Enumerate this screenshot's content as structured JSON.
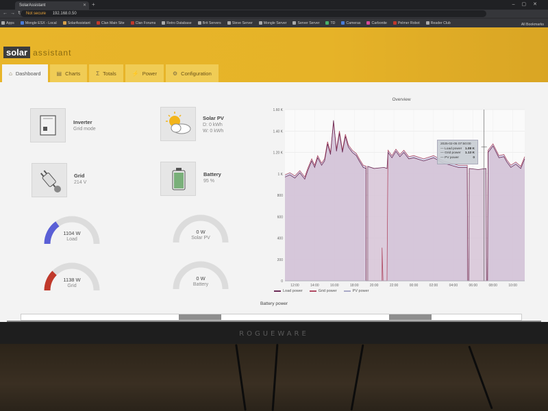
{
  "browser": {
    "tab_title": "SolarAssistant",
    "address_warning": "Not secure",
    "address_url": "192.168.0.50",
    "bookmarks": [
      "Apps",
      "Mongle ESX - Local",
      "SolarAssistant",
      "Clan Main Site",
      "Clan Forums",
      "Retro Database",
      "Brit Servers",
      "Steve Server",
      "Mongle Server",
      "Server Server",
      "TD",
      "Cameras",
      "Carbonite",
      "Pelmer Robot",
      "Reader Club"
    ],
    "all_bookmarks": "All Bookmarks"
  },
  "app": {
    "logo_box": "solar",
    "logo_rest": "assistant",
    "tabs": [
      {
        "label": "Dashboard",
        "icon": "home-icon",
        "active": true
      },
      {
        "label": "Charts",
        "icon": "chart-icon",
        "active": false
      },
      {
        "label": "Totals",
        "icon": "sigma-icon",
        "active": false
      },
      {
        "label": "Power",
        "icon": "bolt-icon",
        "active": false
      },
      {
        "label": "Configuration",
        "icon": "gear-icon",
        "active": false
      }
    ]
  },
  "tiles": {
    "inverter": {
      "title": "Inverter",
      "sub": "Grid mode"
    },
    "solar": {
      "title": "Solar PV",
      "sub1": "D: 0 kWh",
      "sub2": "W: 0 kWh"
    },
    "grid": {
      "title": "Grid",
      "sub": "214 V"
    },
    "battery": {
      "title": "Battery",
      "sub": "95 %"
    }
  },
  "gauges": {
    "load": {
      "value": "1104 W",
      "label": "Load",
      "fraction": 0.3,
      "color": "#5a5fd6"
    },
    "solar": {
      "value": "0 W",
      "label": "Solar PV",
      "fraction": 0,
      "color": "#5a5fd6"
    },
    "grid": {
      "value": "1138 W",
      "label": "Grid",
      "fraction": 0.25,
      "color": "#c0392b"
    },
    "battery": {
      "value": "0 W",
      "label": "Battery",
      "fraction": 0,
      "color": "#5a5fd6"
    }
  },
  "chart_data": {
    "type": "area",
    "title": "Overview",
    "x_ticks": [
      "12:00",
      "14:00",
      "16:00",
      "18:00",
      "20:00",
      "22:00",
      "00:00",
      "02:00",
      "04:00",
      "06:00",
      "08:00",
      "10:00"
    ],
    "y_ticks": [
      "0",
      "200",
      "400",
      "600",
      "800",
      "1 K",
      "1.20 K",
      "1.40 K",
      "1.60 K"
    ],
    "ylim": [
      0,
      1600
    ],
    "xlim": [
      11.0,
      35.2
    ],
    "series": [
      {
        "name": "Load power",
        "color": "#6b2a55",
        "points": [
          [
            11.0,
            970
          ],
          [
            11.5,
            990
          ],
          [
            12.0,
            960
          ],
          [
            12.5,
            1010
          ],
          [
            13.0,
            950
          ],
          [
            13.3,
            1030
          ],
          [
            13.7,
            1120
          ],
          [
            14.0,
            1060
          ],
          [
            14.3,
            1150
          ],
          [
            14.7,
            1080
          ],
          [
            15.0,
            1120
          ],
          [
            15.3,
            1280
          ],
          [
            15.6,
            1180
          ],
          [
            15.9,
            1500
          ],
          [
            16.2,
            1210
          ],
          [
            16.5,
            1380
          ],
          [
            16.8,
            1200
          ],
          [
            17.1,
            1350
          ],
          [
            17.4,
            1250
          ],
          [
            17.8,
            1200
          ],
          [
            18.2,
            1170
          ],
          [
            18.5,
            1120
          ],
          [
            18.9,
            1060
          ],
          [
            19.2,
            1050
          ],
          [
            19.2,
            0
          ],
          [
            19.35,
            0
          ],
          [
            19.35,
            1070
          ],
          [
            20.0,
            1050
          ],
          [
            21.0,
            1060
          ],
          [
            21.3,
            1050
          ],
          [
            21.4,
            1200
          ],
          [
            21.8,
            1150
          ],
          [
            22.2,
            1210
          ],
          [
            22.6,
            1160
          ],
          [
            23.0,
            1200
          ],
          [
            23.5,
            1140
          ],
          [
            24.0,
            1150
          ],
          [
            25.0,
            1120
          ],
          [
            26.0,
            1150
          ],
          [
            27.0,
            1100
          ],
          [
            28.5,
            1060
          ],
          [
            29.4,
            1060
          ],
          [
            29.45,
            0
          ],
          [
            29.55,
            0
          ],
          [
            29.6,
            1050
          ],
          [
            30.5,
            1040
          ],
          [
            31.3,
            1050
          ],
          [
            31.35,
            0
          ],
          [
            31.45,
            0
          ],
          [
            31.5,
            1200
          ],
          [
            32.0,
            1260
          ],
          [
            32.6,
            1150
          ],
          [
            33.1,
            1160
          ],
          [
            33.4,
            1110
          ],
          [
            33.8,
            1060
          ],
          [
            34.3,
            1090
          ],
          [
            34.8,
            1050
          ],
          [
            35.2,
            1140
          ]
        ]
      },
      {
        "name": "Grid power",
        "color": "#b04a63",
        "points": [
          [
            11.0,
            990
          ],
          [
            11.5,
            1010
          ],
          [
            12.0,
            980
          ],
          [
            12.5,
            1030
          ],
          [
            13.0,
            970
          ],
          [
            13.3,
            1050
          ],
          [
            13.7,
            1140
          ],
          [
            14.0,
            1080
          ],
          [
            14.3,
            1170
          ],
          [
            14.7,
            1100
          ],
          [
            15.0,
            1140
          ],
          [
            15.3,
            1300
          ],
          [
            15.6,
            1200
          ],
          [
            15.9,
            1480
          ],
          [
            16.2,
            1230
          ],
          [
            16.5,
            1400
          ],
          [
            16.8,
            1220
          ],
          [
            17.1,
            1370
          ],
          [
            17.4,
            1270
          ],
          [
            17.8,
            1220
          ],
          [
            18.2,
            1190
          ],
          [
            18.5,
            1140
          ],
          [
            18.9,
            1080
          ],
          [
            19.2,
            1070
          ],
          [
            19.2,
            0
          ],
          [
            19.35,
            0
          ],
          [
            20.0,
            0
          ],
          [
            20.8,
            0
          ],
          [
            20.8,
            310
          ],
          [
            20.9,
            0
          ],
          [
            21.0,
            0
          ],
          [
            21.3,
            0
          ],
          [
            21.4,
            1220
          ],
          [
            21.8,
            1170
          ],
          [
            22.2,
            1230
          ],
          [
            22.6,
            1180
          ],
          [
            23.0,
            1220
          ],
          [
            23.5,
            1160
          ],
          [
            24.0,
            1170
          ],
          [
            25.0,
            1140
          ],
          [
            26.0,
            1170
          ],
          [
            27.0,
            1120
          ],
          [
            28.5,
            1080
          ],
          [
            29.4,
            1080
          ],
          [
            29.45,
            0
          ],
          [
            31.35,
            0
          ],
          [
            31.45,
            0
          ],
          [
            31.5,
            1220
          ],
          [
            32.0,
            1280
          ],
          [
            32.6,
            1170
          ],
          [
            33.1,
            1180
          ],
          [
            33.4,
            1130
          ],
          [
            33.8,
            1080
          ],
          [
            34.3,
            1110
          ],
          [
            34.8,
            1070
          ],
          [
            35.2,
            1160
          ]
        ]
      },
      {
        "name": "PV power",
        "color": "#a9a9c7",
        "points": [
          [
            11.0,
            0
          ],
          [
            35.2,
            0
          ]
        ]
      }
    ],
    "crosshair_x": 31.1,
    "tooltip": {
      "time": "2025-02-05 07:50:00",
      "rows": [
        {
          "label": "Load power",
          "value": "1.08 K"
        },
        {
          "label": "Grid power",
          "value": "1.13 K"
        },
        {
          "label": "PV power",
          "value": "0"
        }
      ]
    }
  },
  "battery_power_title": "Battery power",
  "monitor_brand": "ROGUEWARE"
}
